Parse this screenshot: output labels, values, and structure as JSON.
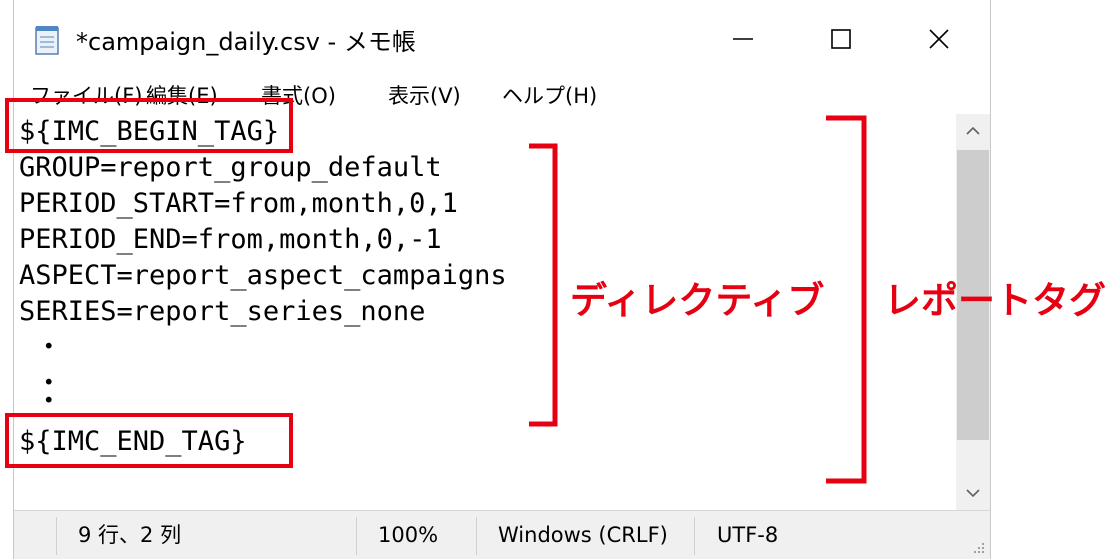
{
  "window": {
    "title": "*campaign_daily.csv - メモ帳",
    "icon": "notepad-icon"
  },
  "controls": {
    "minimize_icon": "minimize-icon",
    "maximize_icon": "maximize-icon",
    "close_icon": "close-icon"
  },
  "menu": {
    "items": [
      "ファイル(F)",
      "編集(E)",
      "書式(O)",
      "表示(V)",
      "ヘルプ(H)"
    ]
  },
  "editor": {
    "lines": [
      "${IMC_BEGIN_TAG}",
      "GROUP=report_group_default",
      "PERIOD_START=from,month,0,1",
      "PERIOD_END=from,month,0,-1",
      "ASPECT=report_aspect_campaigns",
      "SERIES=report_series_none",
      " ・",
      " ・",
      " ・",
      "${IMC_END_TAG}"
    ]
  },
  "statusbar": {
    "position": "9 行、2 列",
    "zoom": "100%",
    "line_ending": "Windows (CRLF)",
    "encoding": "UTF-8"
  },
  "annotations": {
    "directive_label": "ディレクティブ",
    "report_tag_label": "レポートタグ",
    "highlight_color": "#e60012"
  }
}
